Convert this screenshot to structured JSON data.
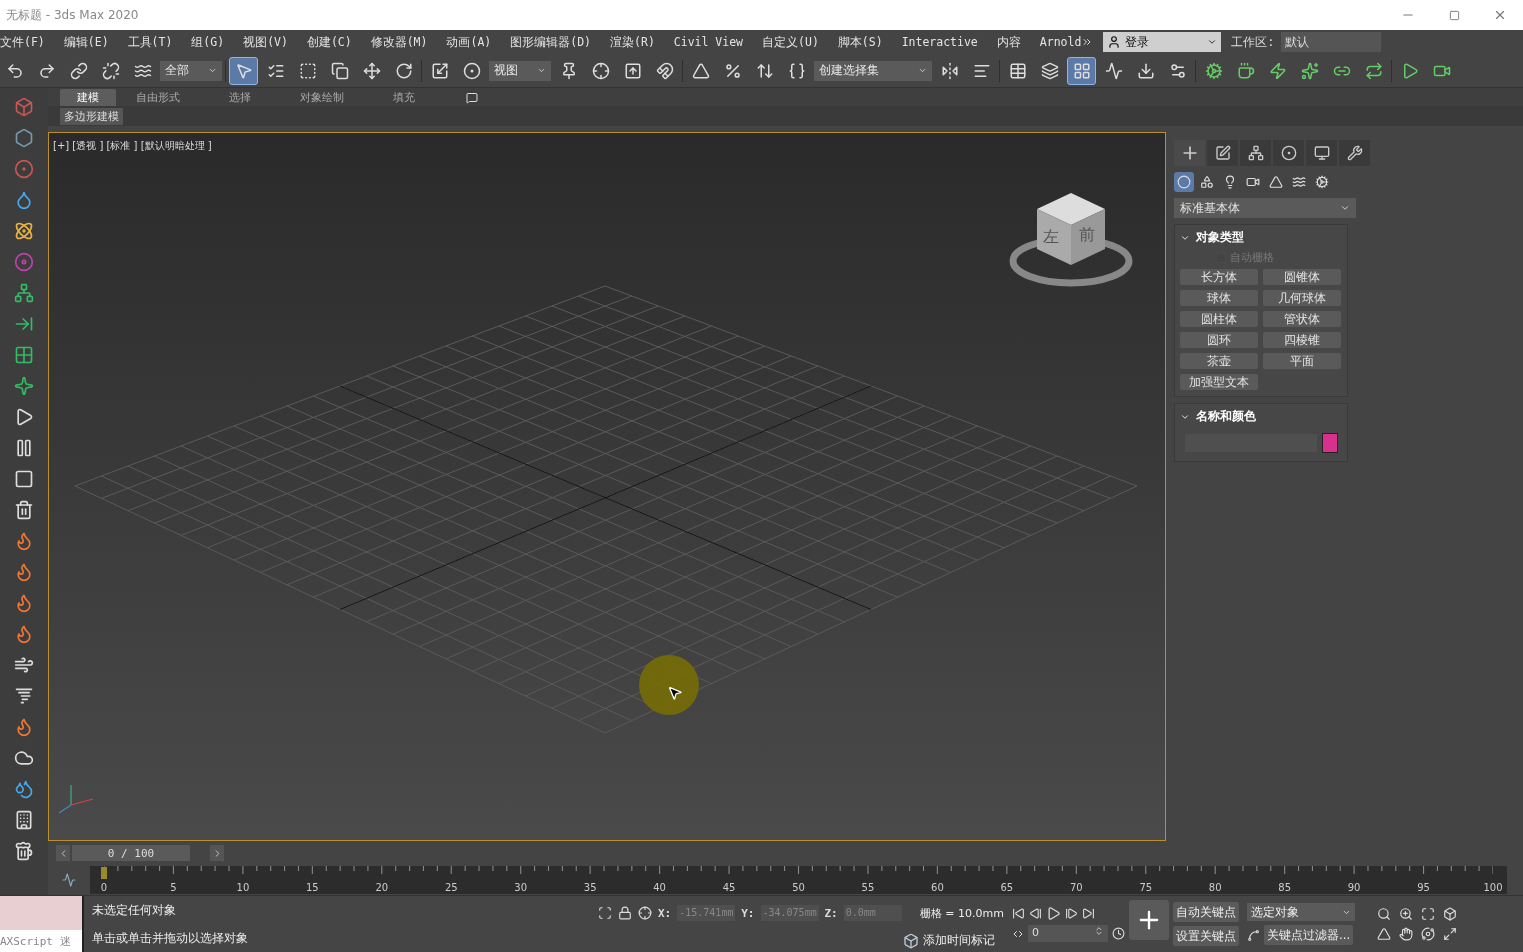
{
  "window": {
    "title": "无标题 - 3ds Max 2020"
  },
  "menu": [
    "文件(F)",
    "编辑(E)",
    "工具(T)",
    "组(G)",
    "视图(V)",
    "创建(C)",
    "修改器(M)",
    "动画(A)",
    "图形编辑器(D)",
    "渲染(R)",
    "Civil View",
    "自定义(U)",
    "脚本(S)",
    "Interactive",
    "内容",
    "Arnold"
  ],
  "account": {
    "label": "登录"
  },
  "workspace": {
    "label": "工作区:",
    "value": "默认"
  },
  "toolbar": {
    "selection_filter": "全部",
    "reference_coord": "视图",
    "named_selection": "创建选择集",
    "tools": [
      {
        "selected": false
      },
      {
        "selected": false
      },
      {
        "selected": false
      },
      {
        "selected": false
      },
      {
        "selected": false
      },
      {
        "selected": true
      },
      {
        "selected": false
      },
      {
        "selected": false
      },
      {
        "selected": false
      },
      {
        "selected": false
      },
      {
        "selected": false
      },
      {
        "selected": false
      },
      {
        "selected": false
      },
      {
        "selected": false
      },
      {
        "selected": false
      },
      {
        "selected": false
      },
      {
        "selected": false
      },
      {
        "selected": false
      },
      {
        "selected": false
      },
      {
        "selected": false
      },
      {
        "selected": false
      },
      {
        "selected": false
      },
      {
        "selected": false
      },
      {
        "selected": false
      },
      {
        "selected": false
      },
      {
        "selected": true
      },
      {
        "selected": false
      },
      {
        "selected": false
      },
      {
        "selected": false
      },
      {
        "selected": false
      },
      {
        "selected": false
      },
      {
        "selected": false
      },
      {
        "selected": false
      },
      {
        "selected": false
      },
      {
        "selected": false
      },
      {
        "selected": false
      },
      {
        "selected": false
      }
    ]
  },
  "ribbon": {
    "tabs": [
      {
        "label": "建模",
        "selected": true
      },
      {
        "label": "自由形式",
        "selected": false
      },
      {
        "label": "选择",
        "selected": false
      },
      {
        "label": "对象绘制",
        "selected": false
      },
      {
        "label": "填充",
        "selected": false
      }
    ],
    "panel": "多边形建模"
  },
  "viewport": {
    "label": "[+] [透视 ] [标准 ] [默认明暗处理 ]",
    "viewcube": [
      "左",
      "前"
    ]
  },
  "command_panel": {
    "tabs": [
      {
        "selected": true
      },
      {
        "selected": false
      },
      {
        "selected": false
      },
      {
        "selected": false
      },
      {
        "selected": false
      },
      {
        "selected": false
      }
    ],
    "categories": [
      {
        "selected": true
      },
      {
        "selected": false
      },
      {
        "selected": false
      },
      {
        "selected": false
      },
      {
        "selected": false
      },
      {
        "selected": false
      },
      {
        "selected": false
      }
    ],
    "dropdown": "标准基本体",
    "object_type": {
      "title": "对象类型",
      "autogrid": {
        "label": "自动栅格",
        "checked": false,
        "disabled": true
      },
      "buttons": [
        "长方体",
        "圆锥体",
        "球体",
        "几何球体",
        "圆柱体",
        "管状体",
        "圆环",
        "四棱锥",
        "茶壶",
        "平面",
        "加强型文本"
      ]
    },
    "name_color": {
      "title": "名称和颜色",
      "color": "#d8308c"
    }
  },
  "timeline": {
    "slider": "0 / 100",
    "level": 0,
    "ticks": [
      "0",
      "5",
      "10",
      "15",
      "20",
      "25",
      "30",
      "35",
      "40",
      "45",
      "50",
      "55",
      "60",
      "65",
      "70",
      "75",
      "80",
      "85",
      "90",
      "95",
      "100"
    ]
  },
  "status": {
    "maxscript": "AXScript 迷",
    "messages": [
      "未选定任何对象",
      "单击或单击并拖动以选择对象"
    ],
    "coords": [
      {
        "axis": "X:",
        "value": "-15.741mm"
      },
      {
        "axis": "Y:",
        "value": "-34.075mm"
      },
      {
        "axis": "Z:",
        "value": "0.0mm"
      }
    ],
    "grid": "栅格 = 10.0mm",
    "time_tag": "添加时间标记",
    "frame": "0",
    "auto_key": "自动关键点",
    "set_key": "设置关键点",
    "key_target": "选定对象",
    "key_filters": "关键点过滤器..."
  }
}
